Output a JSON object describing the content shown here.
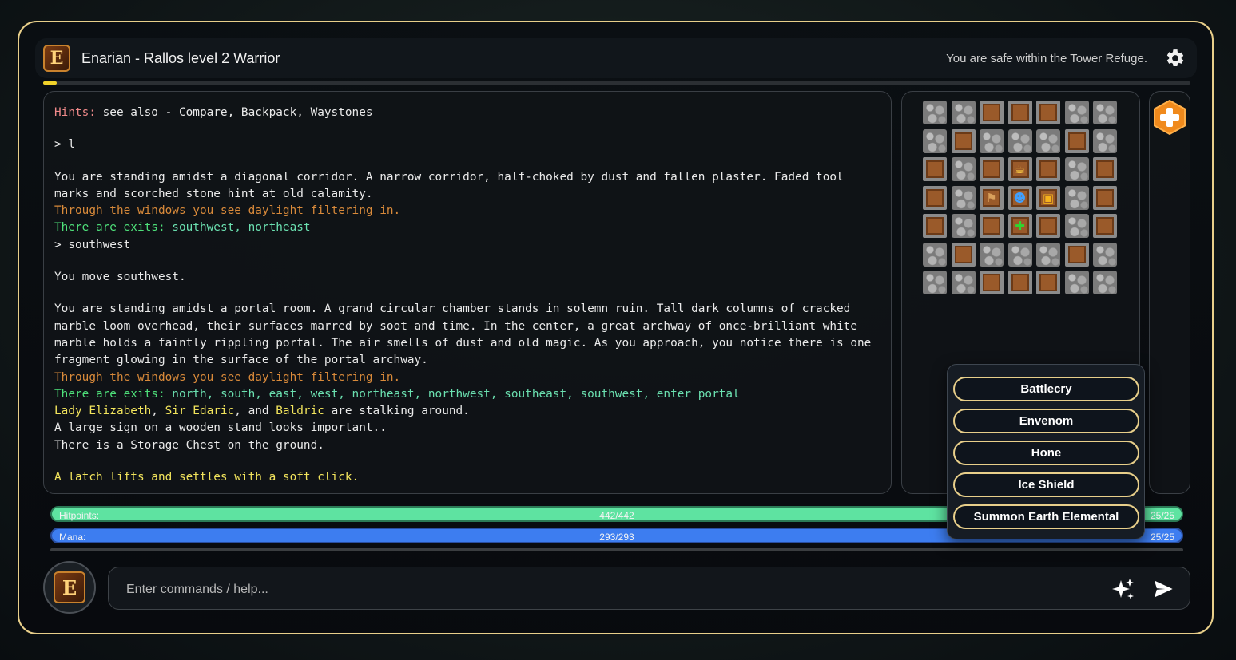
{
  "header": {
    "logo_letter": "E",
    "title": "Enarian - Rallos level 2 Warrior",
    "status": "You are safe within the Tower Refuge."
  },
  "xp": {
    "fraction": 0.012,
    "color": "#f1d22a"
  },
  "log": {
    "hint_label": "Hints:",
    "hint_text": " see also - Compare, Backpack, Waystones",
    "cmd1": "> l",
    "desc1": "You are standing amidst a diagonal corridor. A narrow corridor, half-choked by dust and fallen plaster. Faded tool marks and scorched stone hint at old calamity.",
    "window1": "Through the windows you see daylight filtering in.",
    "exits1_label": "There are exits: ",
    "exits1": "southwest, northeast",
    "cmd2": "> southwest",
    "move": "You move southwest.",
    "desc2": "You are standing amidst a portal room. A grand circular chamber stands in solemn ruin. Tall dark columns of cracked marble loom overhead, their surfaces marred by soot and time. In the center, a great archway of once-brilliant white marble holds a faintly rippling portal. The air smells of dust and old magic. As you approach, you notice there is one fragment glowing in the surface of the portal archway.",
    "window2": "Through the windows you see daylight filtering in.",
    "exits2_label": "There are exits: ",
    "exits2": "north, south, east, west, northeast, northwest, southeast, southwest, enter portal",
    "npc1": "Lady Elizabeth",
    "sep1": ", ",
    "npc2": "Sir Edaric",
    "sep2": ", and ",
    "npc3": "Baldric",
    "npc_tail": " are stalking around.",
    "sign": "A large sign on a wooden stand looks important..",
    "chest": "There is a Storage Chest on the ground.",
    "event": "A latch lifts and settles with a soft click."
  },
  "map": {
    "rows": [
      [
        "stone",
        "stone",
        "floor",
        "floor",
        "floor",
        "stone",
        "stone"
      ],
      [
        "stone",
        "floor",
        "stone",
        "stone",
        "stone",
        "floor",
        "stone"
      ],
      [
        "floor",
        "stone",
        "floor",
        "floor:mug",
        "floor",
        "stone",
        "floor"
      ],
      [
        "floor",
        "stone",
        "floor:sign",
        "floor:player",
        "floor:chest",
        "stone",
        "floor"
      ],
      [
        "floor",
        "stone",
        "floor",
        "floor:cross",
        "floor",
        "stone",
        "floor"
      ],
      [
        "stone",
        "floor",
        "stone",
        "stone",
        "stone",
        "floor",
        "stone"
      ],
      [
        "stone",
        "stone",
        "floor",
        "floor",
        "floor",
        "stone",
        "stone"
      ]
    ]
  },
  "side": {
    "add_icon": "plus-icon"
  },
  "bars": {
    "hp_label": "Hitpoints:",
    "hp_value": "442/442",
    "hp_right": "25/25",
    "hp_fraction": 1.0,
    "mana_label": "Mana:",
    "mana_value": "293/293",
    "mana_right": "25/25",
    "mana_fraction": 1.0
  },
  "spells": [
    "Battlecry",
    "Envenom",
    "Hone",
    "Ice Shield",
    "Summon Earth Elemental"
  ],
  "input": {
    "placeholder": "Enter commands / help..."
  },
  "avatar_letter": "E"
}
